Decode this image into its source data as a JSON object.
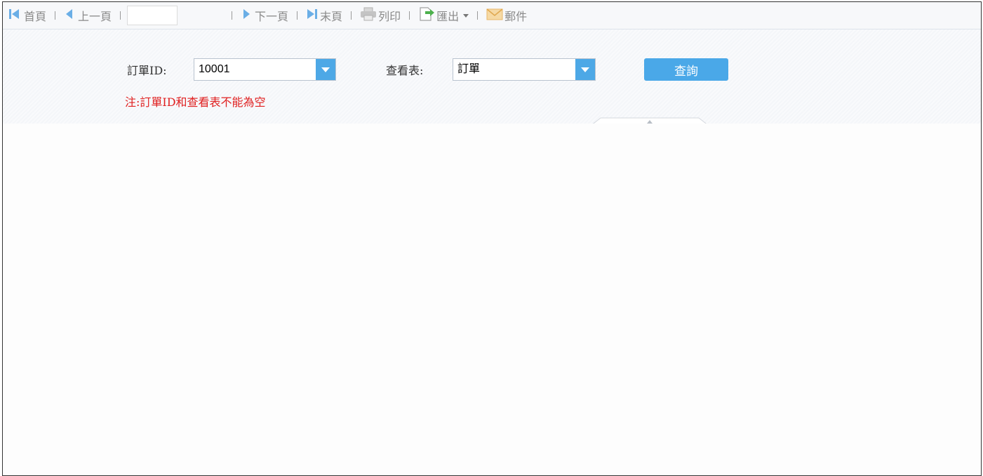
{
  "toolbar": {
    "first_label": "首頁",
    "prev_label": "上一頁",
    "page_input_value": "",
    "next_label": "下一頁",
    "last_label": "末頁",
    "print_label": "列印",
    "export_label": "匯出",
    "mail_label": "郵件"
  },
  "params": {
    "order_id_label": "訂單ID:",
    "order_id_value": "10001",
    "view_table_label": "查看表:",
    "view_table_value": "訂單",
    "query_label": "查詢",
    "note": "注:訂單ID和查看表不能為空"
  },
  "colors": {
    "accent": "#4aa8e8",
    "nav_icon": "#6aaee6",
    "export_icon": "#4cb04c",
    "mail_icon": "#f0c070",
    "note": "#e02020"
  },
  "icons": {
    "first": "first-page-icon",
    "prev": "prev-page-icon",
    "next": "next-page-icon",
    "last": "last-page-icon",
    "print": "printer-icon",
    "export": "export-icon",
    "mail": "mail-icon"
  }
}
